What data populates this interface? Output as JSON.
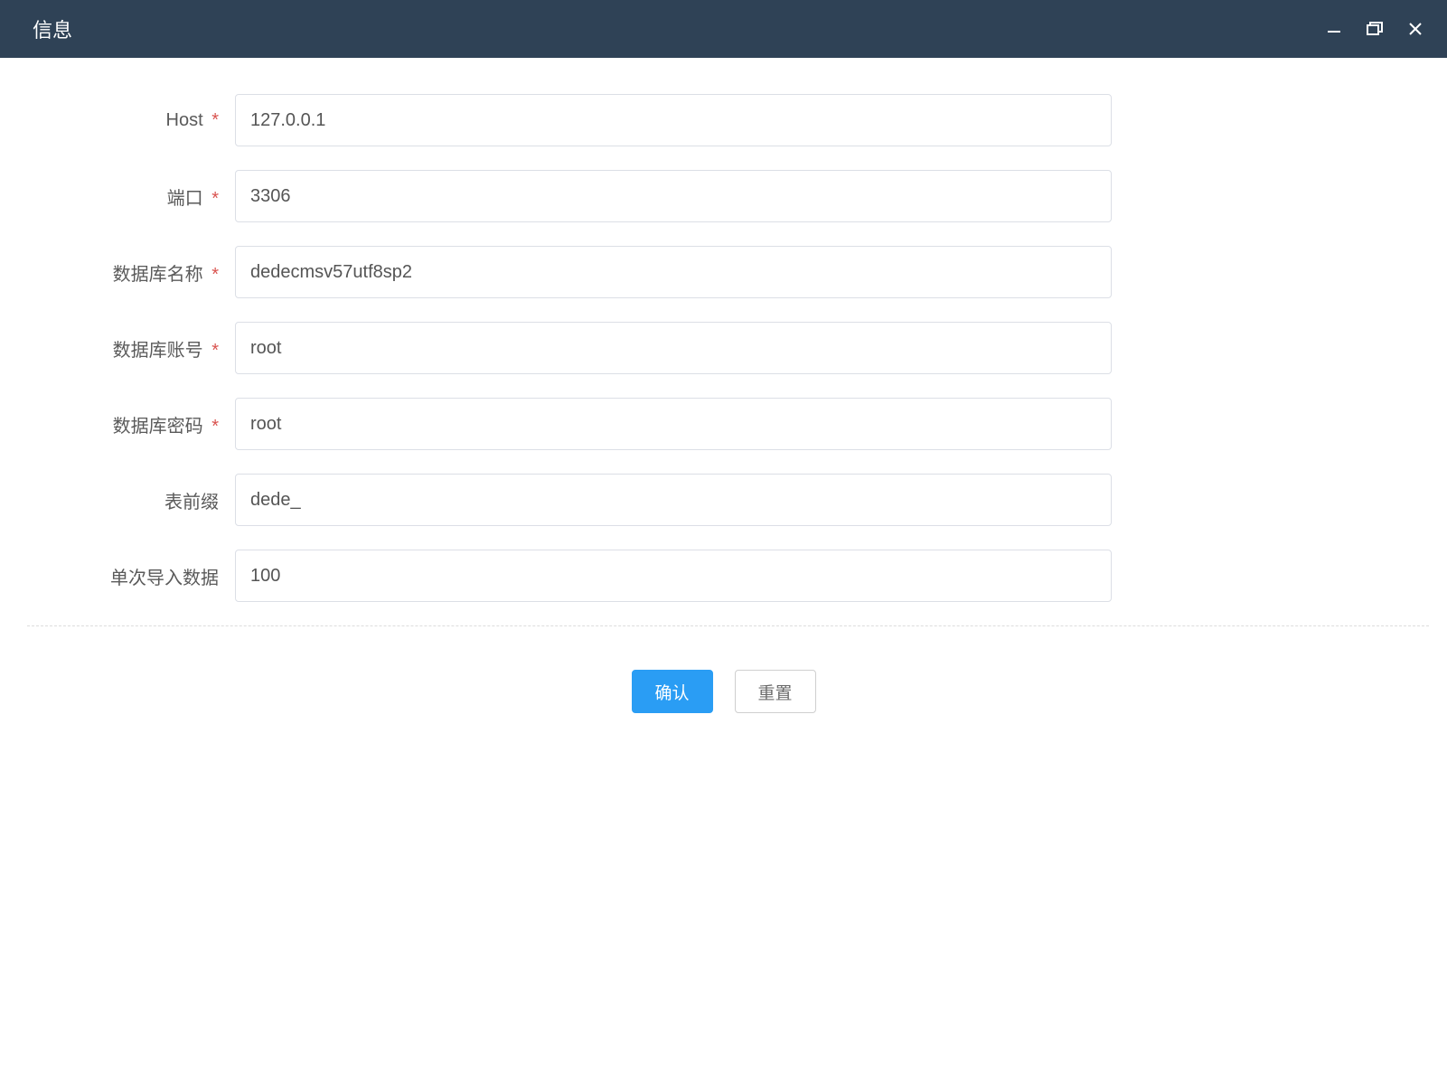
{
  "window": {
    "title": "信息"
  },
  "form": {
    "host": {
      "label": "Host",
      "required_marker": "*",
      "value": "127.0.0.1"
    },
    "port": {
      "label": "端口",
      "required_marker": "*",
      "value": "3306"
    },
    "db_name": {
      "label": "数据库名称",
      "required_marker": "*",
      "value": "dedecmsv57utf8sp2"
    },
    "db_user": {
      "label": "数据库账号",
      "required_marker": "*",
      "value": "root"
    },
    "db_password": {
      "label": "数据库密码",
      "required_marker": "*",
      "value": "root"
    },
    "table_prefix": {
      "label": "表前缀",
      "value": "dede_"
    },
    "batch_size": {
      "label": "单次导入数据",
      "value": "100"
    }
  },
  "buttons": {
    "confirm": "确认",
    "reset": "重置"
  }
}
